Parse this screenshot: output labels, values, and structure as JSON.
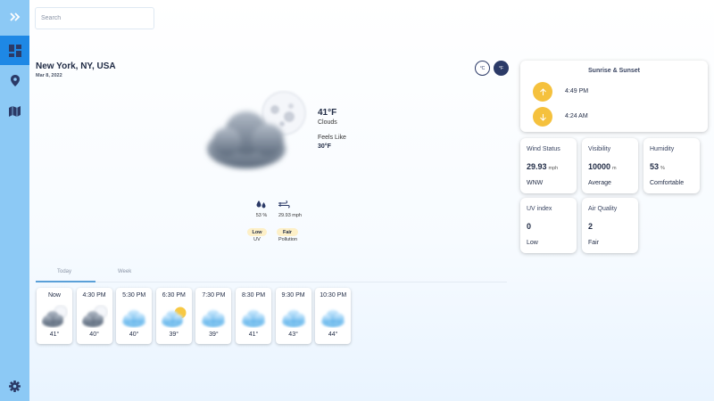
{
  "search": {
    "placeholder": "Search"
  },
  "location": {
    "name": "New York, NY, USA",
    "date": "Mar 8, 2022"
  },
  "units": {
    "celsius": "°C",
    "fahrenheit": "°F"
  },
  "current": {
    "temp": "41°F",
    "condition": "Clouds",
    "feels_like_label": "Feels Like",
    "feels_like_value": "30°F",
    "humidity": "53 %",
    "wind": "29.93 mph",
    "uv_level": "Low",
    "uv_label": "UV",
    "pollution_level": "Fair",
    "pollution_label": "Pollution"
  },
  "tabs": {
    "today": "Today",
    "week": "Week"
  },
  "hourly": [
    {
      "time": "Now",
      "temp": "41°",
      "icon": "cloudy-night-icon"
    },
    {
      "time": "4:30 PM",
      "temp": "40°",
      "icon": "cloudy-night-icon"
    },
    {
      "time": "5:30 PM",
      "temp": "40°",
      "icon": "cloud-icon"
    },
    {
      "time": "6:30 PM",
      "temp": "39°",
      "icon": "partly-sunny-icon"
    },
    {
      "time": "7:30 PM",
      "temp": "39°",
      "icon": "cloud-icon"
    },
    {
      "time": "8:30 PM",
      "temp": "41°",
      "icon": "cloud-icon"
    },
    {
      "time": "9:30 PM",
      "temp": "43°",
      "icon": "cloud-icon"
    },
    {
      "time": "10:30 PM",
      "temp": "44°",
      "icon": "cloud-icon"
    }
  ],
  "sun": {
    "title": "Sunrise & Sunset",
    "sunrise": "4:49 PM",
    "sunset": "4:24 AM"
  },
  "stats": {
    "wind": {
      "title": "Wind Status",
      "value": "29.93",
      "unit": "mph",
      "sub": "WNW"
    },
    "visibility": {
      "title": "Visibility",
      "value": "10000",
      "unit": "m",
      "sub": "Average"
    },
    "humidity": {
      "title": "Humidity",
      "value": "53",
      "unit": "%",
      "sub": "Comfortable"
    },
    "uv": {
      "title": "UV index",
      "value": "0",
      "sub": "Low"
    },
    "air": {
      "title": "Air Quality",
      "value": "2",
      "sub": "Fair"
    }
  },
  "colors": {
    "sidebar": "#8cc9f5",
    "sidebar_active": "#1e88e5",
    "accent": "#f5c13d",
    "pill": "#fdf0c8"
  }
}
